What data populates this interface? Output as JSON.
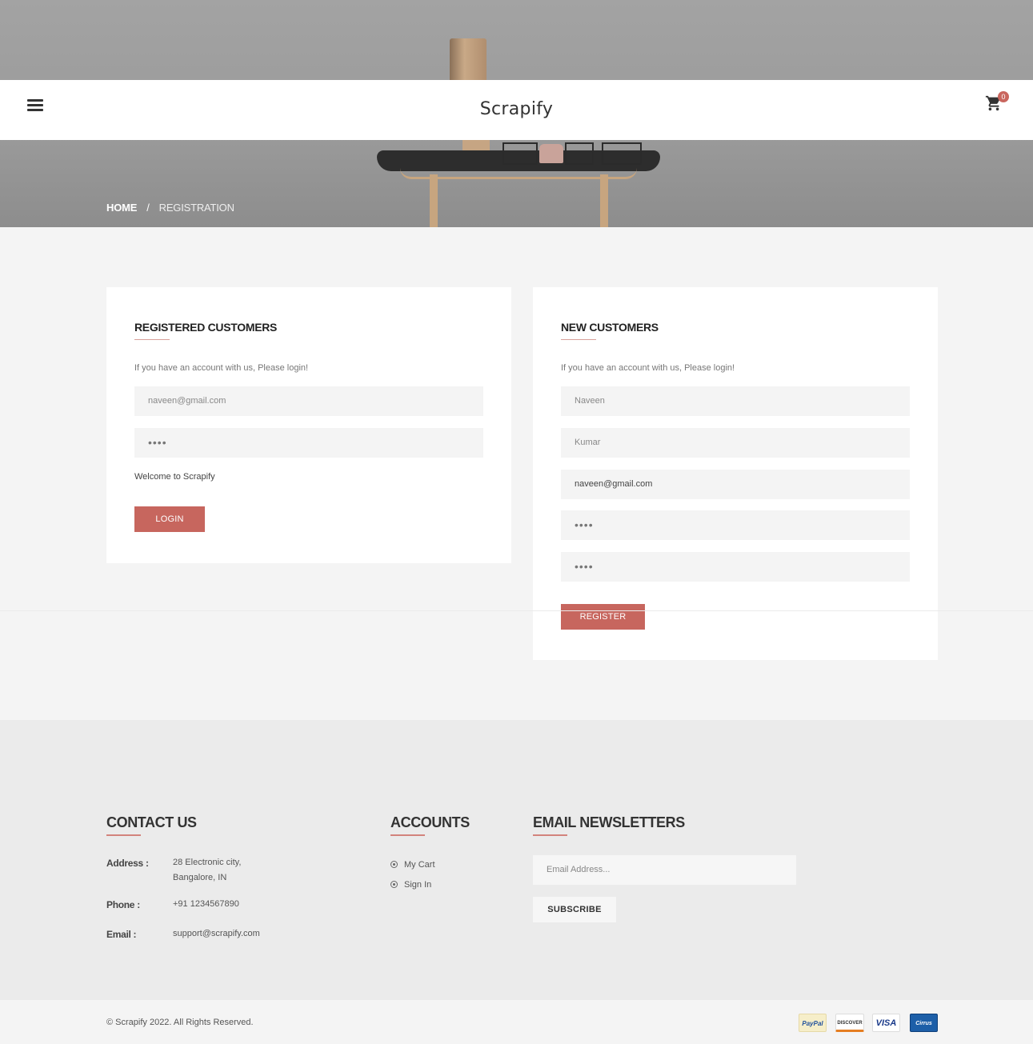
{
  "header": {
    "brand": "Scrapify",
    "cart_count": "0",
    "menu_icon": "hamburger-icon",
    "cart_icon": "shopping-cart-icon"
  },
  "breadcrumb": {
    "home": "HOME",
    "separator": "/",
    "current": "REGISTRATION"
  },
  "login": {
    "title": "REGISTERED CUSTOMERS",
    "hint": "If you have an account with us, Please login!",
    "email_placeholder": "naveen@gmail.com",
    "password_value": "••••",
    "message": "Welcome to Scrapify",
    "button": "LOGIN"
  },
  "register": {
    "title": "NEW CUSTOMERS",
    "hint": "If you have an account with us, Please login!",
    "first_name_placeholder": "Naveen",
    "last_name_placeholder": "Kumar",
    "email_value": "naveen@gmail.com",
    "password_value": "••••",
    "confirm_password_value": "••••",
    "button": "REGISTER"
  },
  "footer": {
    "contact": {
      "title": "CONTACT US",
      "address_label": "Address :",
      "address_line1": "28 Electronic city,",
      "address_line2": "Bangalore, IN",
      "phone_label": "Phone :",
      "phone": "+91 1234567890",
      "email_label": "Email :",
      "email": "support@scrapify.com"
    },
    "accounts": {
      "title": "ACCOUNTS",
      "items": [
        "My Cart",
        "Sign In"
      ]
    },
    "newsletter": {
      "title": "EMAIL NEWSLETTERS",
      "placeholder": "Email Address...",
      "button": "SUBSCRIBE"
    },
    "copyright": "© Scrapify 2022. All Rights Reserved.",
    "payments": {
      "paypal": "PayPal",
      "discover": "DISCOVER",
      "visa": "VISA",
      "cirrus": "Cirrus"
    }
  },
  "colors": {
    "accent": "#c7665e",
    "panel_bg": "#ffffff",
    "page_bg": "#f4f4f4",
    "footer_bg": "#ebebeb"
  }
}
